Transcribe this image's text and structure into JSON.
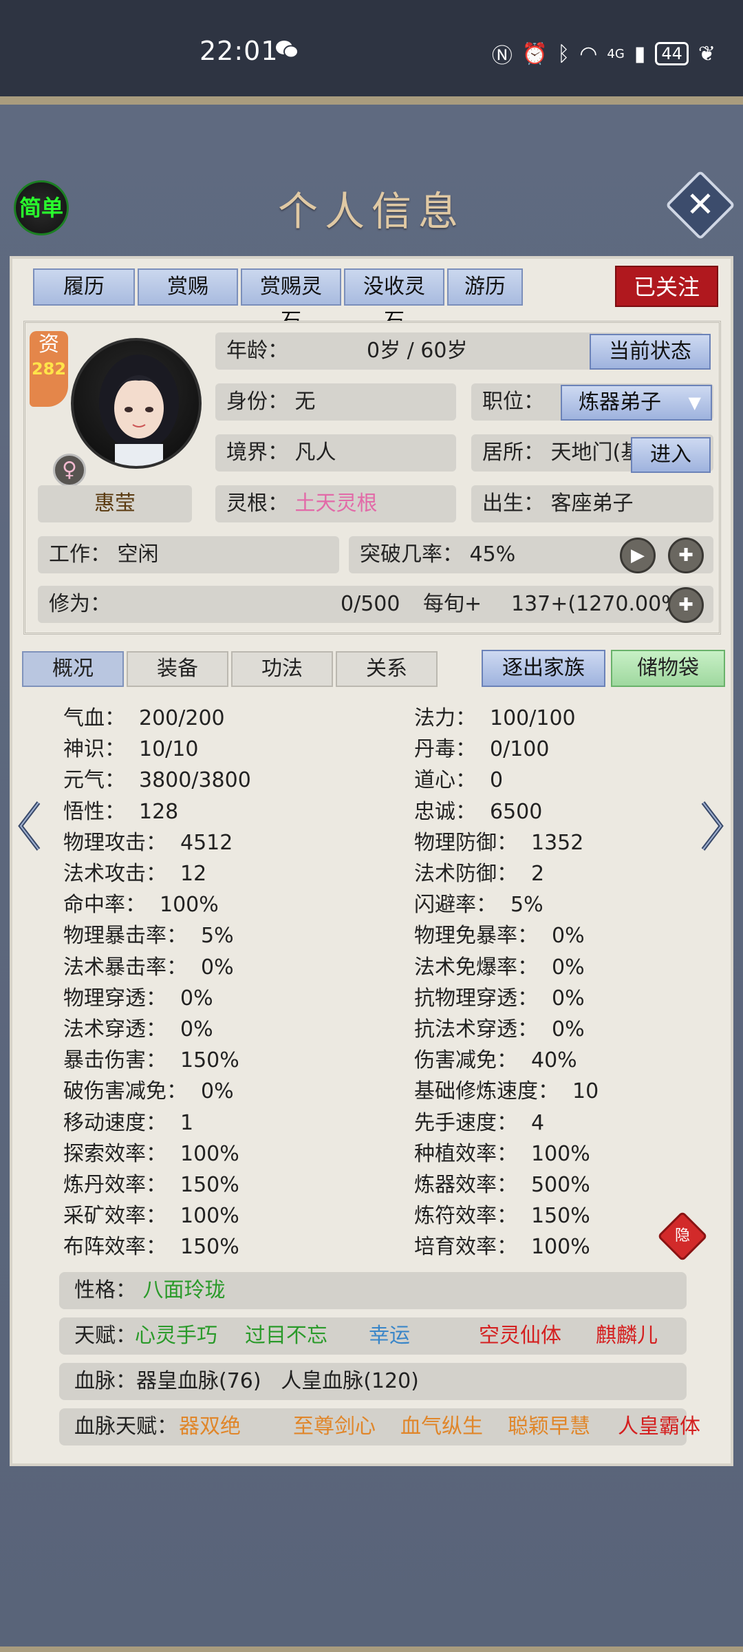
{
  "status_bar": {
    "time": "22:01",
    "battery": "44",
    "network": "4G"
  },
  "header": {
    "simple_label": "简单",
    "title": "个人信息"
  },
  "top_tabs": [
    "履历",
    "赏赐",
    "赏赐灵石",
    "没收灵石",
    "游历"
  ],
  "followed_label": "已关注",
  "profile": {
    "zi_label": "资",
    "zi_value": "282",
    "gender_symbol": "♀",
    "name": "惠莹",
    "age_label": "年龄：",
    "age_value": "0岁 / 60岁",
    "current_status_btn": "当前状态",
    "identity_label": "身份：",
    "identity_value": "无",
    "position_label": "职位：",
    "position_value": "炼器弟子",
    "realm_label": "境界：",
    "realm_value": "凡人",
    "residence_label": "居所：",
    "residence_value": "天地门(基",
    "enter_btn": "进入",
    "root_label": "灵根：",
    "root_value": "土天灵根",
    "birth_label": "出生：",
    "birth_value": "客座弟子",
    "work_label": "工作：",
    "work_value": "空闲",
    "breakthrough_label": "突破几率：",
    "breakthrough_value": "45%",
    "cultivation_label": "修为：",
    "cultivation_value": "0/500",
    "per_turn_label": "每旬+",
    "per_turn_value": "137+(1270.00%)"
  },
  "mid_tabs": [
    "概况",
    "装备",
    "功法",
    "关系"
  ],
  "expel_btn": "逐出家族",
  "storage_btn": "储物袋",
  "stats_left": [
    {
      "label": "气血：",
      "value": "200/200"
    },
    {
      "label": "神识：",
      "value": "10/10"
    },
    {
      "label": "元气：",
      "value": "3800/3800"
    },
    {
      "label": "悟性：",
      "value": "128"
    },
    {
      "label": "物理攻击：",
      "value": "4512"
    },
    {
      "label": "法术攻击：",
      "value": "12"
    },
    {
      "label": "命中率：",
      "value": "100%"
    },
    {
      "label": "物理暴击率：",
      "value": "5%"
    },
    {
      "label": "法术暴击率：",
      "value": "0%"
    },
    {
      "label": "物理穿透：",
      "value": "0%"
    },
    {
      "label": "法术穿透：",
      "value": "0%"
    },
    {
      "label": "暴击伤害：",
      "value": "150%"
    },
    {
      "label": "破伤害减免：",
      "value": "0%"
    },
    {
      "label": "移动速度：",
      "value": "1"
    },
    {
      "label": "探索效率：",
      "value": "100%"
    },
    {
      "label": "炼丹效率：",
      "value": "150%"
    },
    {
      "label": "采矿效率：",
      "value": "100%"
    },
    {
      "label": "布阵效率：",
      "value": "150%"
    }
  ],
  "stats_right": [
    {
      "label": "法力：",
      "value": "100/100"
    },
    {
      "label": "丹毒：",
      "value": "0/100"
    },
    {
      "label": "道心：",
      "value": "0"
    },
    {
      "label": "忠诚：",
      "value": "6500"
    },
    {
      "label": "物理防御：",
      "value": "1352"
    },
    {
      "label": "法术防御：",
      "value": "2"
    },
    {
      "label": "闪避率：",
      "value": "5%"
    },
    {
      "label": "物理免暴率：",
      "value": "0%"
    },
    {
      "label": "法术免爆率：",
      "value": "0%"
    },
    {
      "label": "抗物理穿透：",
      "value": "0%"
    },
    {
      "label": "抗法术穿透：",
      "value": "0%"
    },
    {
      "label": "伤害减免：",
      "value": "40%"
    },
    {
      "label": "基础修炼速度：",
      "value": "10"
    },
    {
      "label": "先手速度：",
      "value": "4"
    },
    {
      "label": "种植效率：",
      "value": "100%"
    },
    {
      "label": "炼器效率：",
      "value": "500%"
    },
    {
      "label": "炼符效率：",
      "value": "150%"
    },
    {
      "label": "培育效率：",
      "value": "100%"
    }
  ],
  "personality": {
    "label": "性格：",
    "value": "八面玲珑",
    "color": "#2a9a2a"
  },
  "talents": {
    "label": "天赋：",
    "items": [
      {
        "text": "心灵手巧",
        "color": "#2a9a2a"
      },
      {
        "text": "过目不忘",
        "color": "#2a9a2a"
      },
      {
        "text": "幸运",
        "color": "#3a86c8"
      },
      {
        "text": "空灵仙体",
        "color": "#d42020"
      },
      {
        "text": "麒麟儿",
        "color": "#d42020"
      }
    ],
    "hide_label": "隐"
  },
  "bloodline": {
    "label": "血脉：",
    "value": "器皇血脉(76)   人皇血脉(120)"
  },
  "bloodline_talents": {
    "label": "血脉天赋：",
    "items": [
      {
        "text": "器双绝",
        "color": "#e0862a"
      },
      {
        "text": "至尊剑心",
        "color": "#e0862a"
      },
      {
        "text": "血气纵生",
        "color": "#e0862a"
      },
      {
        "text": "聪颖早慧",
        "color": "#e0862a"
      },
      {
        "text": "人皇霸体",
        "color": "#d42020"
      }
    ]
  }
}
